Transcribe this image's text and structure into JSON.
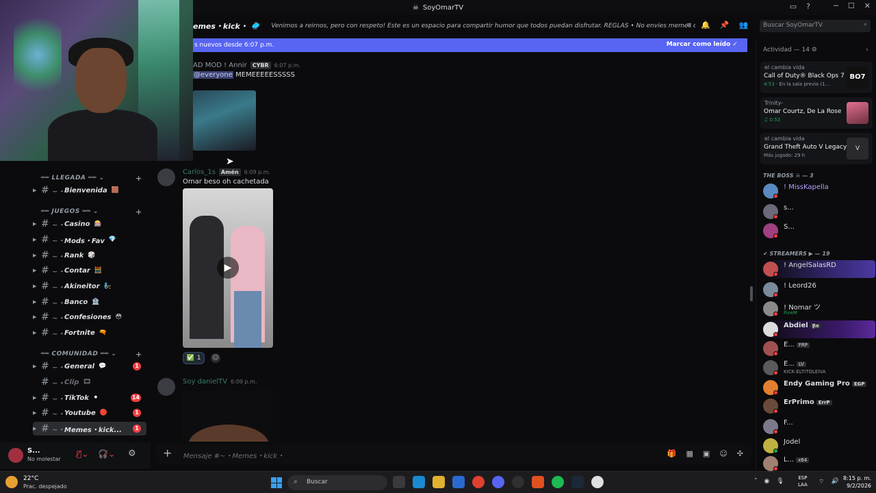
{
  "window": {
    "title": "SoyOmarTV"
  },
  "channel_header": {
    "name": "emes・kick・",
    "topic": "Venimos a reirnos, pero con respeto! Este es un espacio para compartir humor que todos puedan disfrutar. REGLAS  • No envíes memes que contenga...",
    "search_placeholder": "Buscar SoyOmarTV"
  },
  "new_messages_bar": {
    "text": "s nuevos desde 6:07 p.m.",
    "action": "Marcar como leído"
  },
  "sidebar": {
    "categories": [
      {
        "label": "LLEGADA",
        "channels": [
          {
            "name": "Bienvenida",
            "badge": ""
          }
        ]
      },
      {
        "label": "JUEGOS",
        "channels": [
          {
            "name": "Casino",
            "badge": ""
          },
          {
            "name": "Mods・Fav",
            "badge": ""
          },
          {
            "name": "Rank",
            "badge": ""
          },
          {
            "name": "Contar",
            "badge": ""
          },
          {
            "name": "Akineitor",
            "badge": ""
          },
          {
            "name": "Banco",
            "badge": ""
          },
          {
            "name": "Confesiones",
            "badge": ""
          },
          {
            "name": "Fortnite",
            "badge": ""
          }
        ]
      },
      {
        "label": "COMUNIDAD",
        "channels": [
          {
            "name": "General",
            "badge": "1"
          },
          {
            "name": "Clip",
            "badge": ""
          },
          {
            "name": "TikTok",
            "badge": "14"
          },
          {
            "name": "Youtube",
            "badge": "1"
          },
          {
            "name": "Memes・kick...",
            "badge": "1"
          }
        ]
      }
    ]
  },
  "user_panel": {
    "name": "S...",
    "status": "No molestar"
  },
  "messages": [
    {
      "author": "AD MOD ! Annir",
      "tag": "CYBR",
      "time": "6:07 p.m.",
      "mention": "everyone",
      "text": "MEMEEEEESSSSS"
    },
    {
      "author": "Carlos_1s",
      "tag": "Amén",
      "time": "6:09 p.m.",
      "text": "Omar beso oh cachetada",
      "reaction_count": "1"
    },
    {
      "author": "Soy danielTV",
      "time": "6:09 p.m."
    }
  ],
  "composer": {
    "placeholder": "Mensaje #~・Memes・kick・"
  },
  "members": {
    "activity_title": "Actividad — 14",
    "activities": [
      {
        "who": "el cambia vida",
        "game": "Call of Duty® Black Ops 7",
        "meta_time": "4:53",
        "meta_text": "En la sala previa (1...",
        "thumb_text": "BO7"
      },
      {
        "who": "Trinity-",
        "game": "Omar Courtz, De La Rose",
        "meta_time": "0:53",
        "meta_text": ""
      },
      {
        "who": "el cambia vida",
        "game": "Grand Theft Auto V Legacy",
        "meta_time": "",
        "meta_text": "Más jugado: 29 h"
      }
    ],
    "group1": "THE BOSS",
    "group1_count": "— 3",
    "boss": [
      {
        "name": "! MissKapella",
        "sub": "",
        "tag": ""
      },
      {
        "name": "s...",
        "sub": "",
        "tag": ""
      },
      {
        "name": "S...",
        "sub": "",
        "tag": ""
      }
    ],
    "group2": "STREAMERS",
    "group2_count": "— 19",
    "streamers": [
      {
        "name": "! AngelSalasRD",
        "sub": "",
        "tag": ""
      },
      {
        "name": "! Leord26",
        "sub": "",
        "tag": ""
      },
      {
        "name": "! Nomar ツ",
        "sub": "FiveM",
        "tag": ""
      },
      {
        "name": "Abdiel",
        "sub": "",
        "tag": "Ɽe"
      },
      {
        "name": "E...",
        "sub": "",
        "tag": "FRP"
      },
      {
        "name": "E...",
        "sub": "KICK:ELTITOLEIVA",
        "tag": "LV"
      },
      {
        "name": "Endy Gaming Pro",
        "sub": "",
        "tag": "EGP"
      },
      {
        "name": "ErPrimo",
        "sub": "",
        "tag": "ErrP"
      },
      {
        "name": "F...",
        "sub": "",
        "tag": ""
      },
      {
        "name": "Jodel",
        "sub": "",
        "tag": ""
      },
      {
        "name": "L...",
        "sub": "",
        "tag": "x64"
      }
    ]
  },
  "taskbar": {
    "temp": "22°C",
    "condition": "Prac. despejado",
    "search": "Buscar",
    "lang1": "ESP",
    "lang2": "LAA",
    "time": "8:15 p. m.",
    "date": "9/2/2026"
  }
}
